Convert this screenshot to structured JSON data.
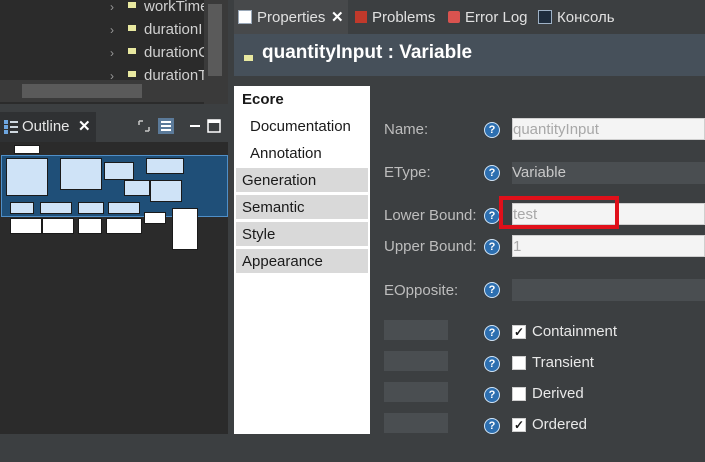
{
  "tree": {
    "items": [
      {
        "label": "workTime",
        "icon": "variable-icon"
      },
      {
        "label": "durationI",
        "icon": "variable-icon"
      },
      {
        "label": "durationC",
        "icon": "variable-icon"
      },
      {
        "label": "durationT",
        "icon": "variable-icon"
      }
    ]
  },
  "outline": {
    "tab_label": "Outline",
    "close_glyph": "✕"
  },
  "right_tabs": [
    {
      "label": "Properties",
      "icon": "properties-icon"
    },
    {
      "label": "Problems",
      "icon": "problems-icon"
    },
    {
      "label": "Error Log",
      "icon": "error-log-icon"
    },
    {
      "label": "Консоль",
      "icon": "console-icon"
    }
  ],
  "properties": {
    "close_glyph": "✕",
    "title": "quantityInput : Variable",
    "sidebar": [
      {
        "label": "Ecore"
      },
      {
        "label": "Documentation"
      },
      {
        "label": "Annotation"
      },
      {
        "label": "Generation"
      },
      {
        "label": "Semantic"
      },
      {
        "label": "Style"
      },
      {
        "label": "Appearance"
      }
    ],
    "fields": {
      "name_label": "Name:",
      "name_value": "quantityInput",
      "etype_label": "EType:",
      "etype_value": "Variable",
      "lower_label": "Lower Bound:",
      "lower_value": "test",
      "upper_label": "Upper Bound:",
      "upper_value": "1",
      "eopposite_label": "EOpposite:",
      "eopposite_value": ""
    },
    "help_glyph": "?",
    "checkboxes": [
      {
        "label": "Containment",
        "checked": true,
        "mark": "✓"
      },
      {
        "label": "Transient",
        "checked": false,
        "mark": ""
      },
      {
        "label": "Derived",
        "checked": false,
        "mark": ""
      },
      {
        "label": "Ordered",
        "checked": true,
        "mark": "✓"
      }
    ]
  },
  "colors": {
    "highlight": "#e0101a",
    "help_blue": "#2d6fb0",
    "header_bg": "#46505a"
  }
}
